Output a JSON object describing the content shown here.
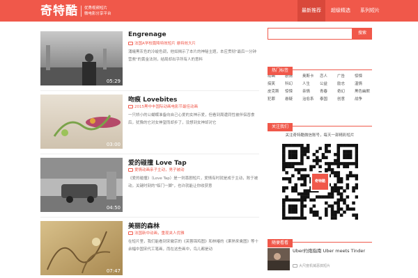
{
  "header": {
    "logo": "奇特酷",
    "slogan_line1": "优秀视频短片",
    "slogan_line2": "微电影分享平台",
    "nav": [
      {
        "label": "最新推荐",
        "active": true
      },
      {
        "label": "超级精选",
        "active": false
      },
      {
        "label": "系列短片",
        "active": false
      }
    ]
  },
  "videos": [
    {
      "title": "Engrenage",
      "tags": "法国A学校篇降特效短片 悬特效大片",
      "desc": "涌蛾黑灰色的冷峻色调，他如揭示了本片的神秘主题，本应贯彻\"最后一分钟营救\"的黄金法则，结局却出乎所有人的意料",
      "duration": "05:29"
    },
    {
      "title": "吻痕 Lovebites",
      "tags": "2015黑中丰国际动画电影节最佳动画",
      "desc": "一只矫小的公蝴蝶准备向自己心爱的女神示爱，但看到周遭同性被伴侣吞食后，犹豫的它对女神望而却步了，没想到女神却对它",
      "duration": "03:00"
    },
    {
      "title": "爱的碰撞 Love Tap",
      "tags": "爱情动画亲子主动，男子被动",
      "desc": "《爱的碰撞》（Love Tap）是一则喜剧短片，爱情有时就是成于主动，败于被动，关键时刻的\"临门一脚\"，也许就能让你收获意",
      "duration": "04:50"
    },
    {
      "title": "美丽的森林",
      "tags": "法国新中动画，重现夹人优雅",
      "desc": "在短片里，我们能看到宋徽宗的《芙蓉锦鸡图》和林椿的《果熟来禽图》等十余幅中国宋代工笔画，而在这些画中，鸟儿都是动",
      "duration": "07:47"
    }
  ],
  "sidebar": {
    "search_placeholder": "",
    "search_button": "搜索",
    "hot_tags_title": "热门标签",
    "hot_tags": [
      "动画",
      "剧情",
      "奥斯卡",
      "恋人",
      "广告",
      "惊悚",
      "搞笑",
      "科幻",
      "人生",
      "公益",
      "励志",
      "温情",
      "皮克斯",
      "惊悚",
      "亲情",
      "青春",
      "奇幻",
      "黑色幽默",
      "犯罪",
      "悬疑",
      "治愈系",
      "泰国",
      "创意",
      "战争"
    ],
    "follow_title": "关注我们",
    "follow_text": "关注奇特酷微信账号，每天一部精彩短片",
    "qr_logo": "奇特酷",
    "recommend_title": "随便看看",
    "recommend": [
      {
        "title": "Uber约炮指南 Uber meets Tinder",
        "tags": "大尺度机械恶搞短片",
        "duration": "01:12"
      }
    ]
  },
  "colors": {
    "accent": "#f0584a",
    "accent_dark": "#d9483b"
  }
}
